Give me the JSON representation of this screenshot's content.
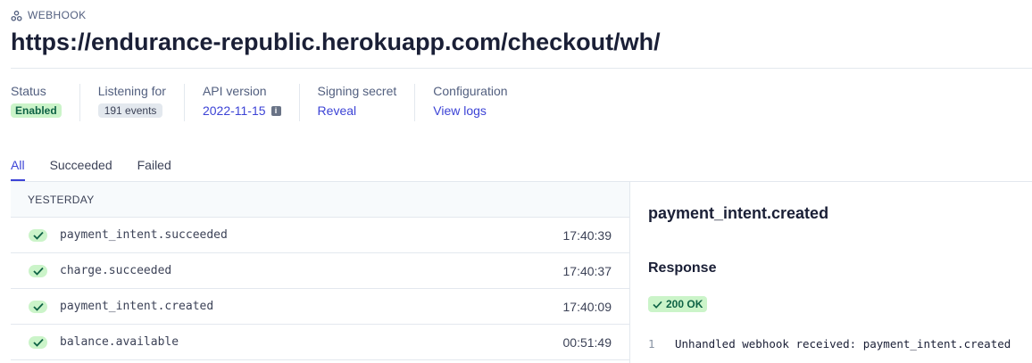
{
  "header": {
    "eyebrow_icon": "webhook-icon",
    "eyebrow": "WEBHOOK",
    "url": "https://endurance-republic.herokuapp.com/checkout/wh/"
  },
  "meta": {
    "status_label": "Status",
    "status_value": "Enabled",
    "listening_label": "Listening for",
    "listening_value": "191 events",
    "api_label": "API version",
    "api_value": "2022-11-15",
    "api_info_icon": "info-icon",
    "secret_label": "Signing secret",
    "secret_value": "Reveal",
    "config_label": "Configuration",
    "config_value": "View logs"
  },
  "tabs": [
    {
      "label": "All",
      "active": true
    },
    {
      "label": "Succeeded",
      "active": false
    },
    {
      "label": "Failed",
      "active": false
    }
  ],
  "events": {
    "group_label": "YESTERDAY",
    "rows": [
      {
        "name": "payment_intent.succeeded",
        "time": "17:40:39",
        "status_icon": "check-icon"
      },
      {
        "name": "charge.succeeded",
        "time": "17:40:37",
        "status_icon": "check-icon"
      },
      {
        "name": "payment_intent.created",
        "time": "17:40:09",
        "status_icon": "check-icon"
      },
      {
        "name": "balance.available",
        "time": "00:51:49",
        "status_icon": "check-icon"
      }
    ]
  },
  "detail": {
    "event_title": "payment_intent.created",
    "response_title": "Response",
    "status_badge": "200 OK",
    "code_line_number": "1",
    "code_line_text": "Unhandled webhook received: payment_intent.created"
  },
  "colors": {
    "accent": "#3c43d6",
    "success_bg": "#cbf4c9",
    "success_fg": "#0e6245",
    "border": "#e3e8ee"
  }
}
